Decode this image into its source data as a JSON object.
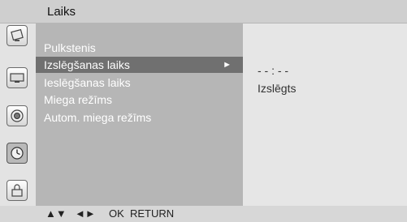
{
  "window": {
    "title": "Laiks"
  },
  "sidebar": {
    "icons": [
      {
        "name": "tv-tilt-icon"
      },
      {
        "name": "picture-icon"
      },
      {
        "name": "audio-icon"
      },
      {
        "name": "clock-icon",
        "active": true
      },
      {
        "name": "lock-icon"
      }
    ]
  },
  "menu": {
    "items": [
      {
        "label": "Pulkstenis"
      },
      {
        "label": "Izslēgšanas laiks",
        "selected": true,
        "arrow": "►"
      },
      {
        "label": "Ieslēgšanas laiks"
      },
      {
        "label": "Miega režīms"
      },
      {
        "label": "Autom. miega režīms"
      }
    ]
  },
  "values": {
    "time": "- - : - -",
    "status": "Izslēgts"
  },
  "footer": {
    "nav_updown": "▲▼",
    "nav_leftright": "◄►",
    "ok": "OK",
    "return": "RETURN"
  },
  "colors": {
    "menu_bg": "#b6b6b6",
    "selected_bg": "#707070",
    "value_bg": "#e6e6e6",
    "header_bg": "#cfcfcf"
  }
}
